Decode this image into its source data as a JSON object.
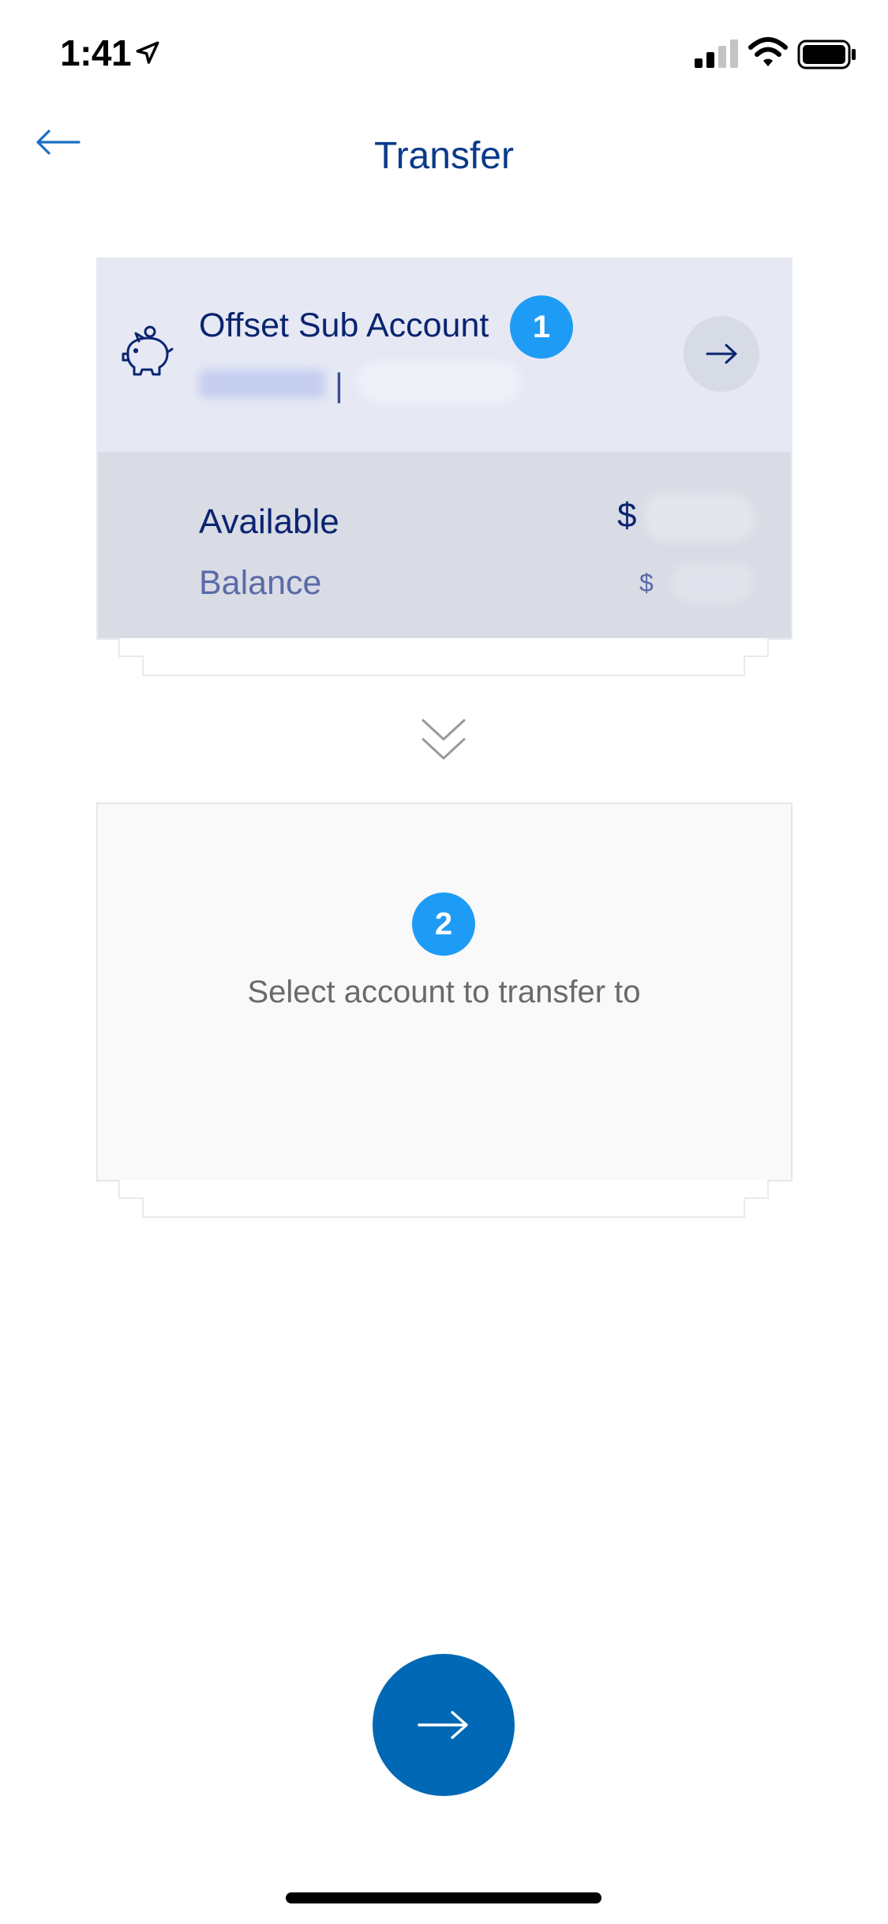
{
  "status_bar": {
    "time": "1:41",
    "icons": [
      "location-arrow-icon",
      "signal-icon",
      "wifi-icon",
      "battery-icon"
    ]
  },
  "header": {
    "title": "Transfer",
    "back_icon": "arrow-left-icon"
  },
  "from_account": {
    "step": "1",
    "name": "Offset Sub Account",
    "separator": "|",
    "available_label": "Available",
    "balance_label": "Balance",
    "available_currency": "$",
    "balance_currency": "$",
    "icon": "piggy-bank-icon"
  },
  "to_account": {
    "step": "2",
    "prompt": "Select account to transfer to"
  },
  "colors": {
    "primary_blue": "#0068b4",
    "badge_blue": "#1e9cf5",
    "title_blue": "#0a3a8a",
    "dark_navy": "#0a2470"
  }
}
